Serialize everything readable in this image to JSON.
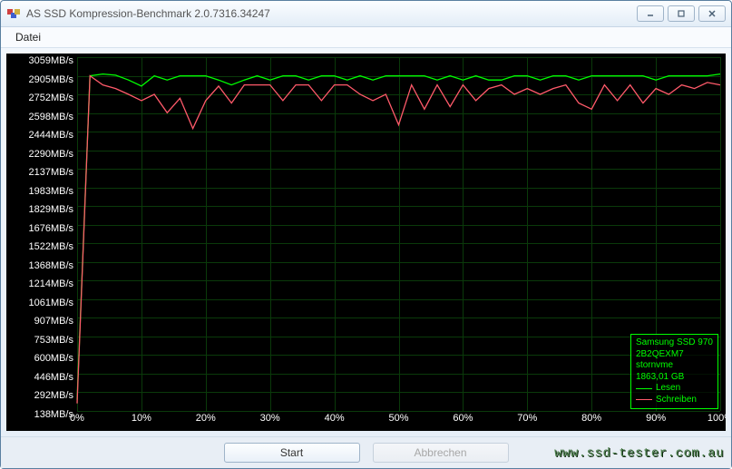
{
  "window": {
    "title": "AS SSD Kompression-Benchmark 2.0.7316.34247"
  },
  "menu": {
    "file": "Datei"
  },
  "buttons": {
    "start": "Start",
    "cancel": "Abbrechen"
  },
  "legend": {
    "device_line1": "Samsung SSD 970",
    "device_line2": "2B2QEXM7",
    "device_line3": "stornvme",
    "device_line4": "1863,01 GB",
    "read": "Lesen",
    "write": "Schreiben",
    "read_color": "#00ff00",
    "write_color": "#ff5a6a"
  },
  "watermark": "www.ssd-tester.com.au",
  "chart_data": {
    "type": "line",
    "title": "",
    "xlabel": "",
    "ylabel": "",
    "y_unit": "MB/s",
    "xlim": [
      0,
      100
    ],
    "ylim": [
      138,
      3059
    ],
    "y_ticks": [
      3059,
      2905,
      2752,
      2598,
      2444,
      2290,
      2137,
      1983,
      1829,
      1676,
      1522,
      1368,
      1214,
      1061,
      907,
      753,
      600,
      446,
      292,
      138
    ],
    "x_ticks": [
      0,
      10,
      20,
      30,
      40,
      50,
      60,
      70,
      80,
      90,
      100
    ],
    "x": [
      0,
      2,
      4,
      6,
      8,
      10,
      12,
      14,
      16,
      18,
      20,
      22,
      24,
      26,
      28,
      30,
      32,
      34,
      36,
      38,
      40,
      42,
      44,
      46,
      48,
      50,
      52,
      54,
      56,
      58,
      60,
      62,
      64,
      66,
      68,
      70,
      72,
      74,
      76,
      78,
      80,
      82,
      84,
      86,
      88,
      90,
      92,
      94,
      96,
      98,
      100
    ],
    "series": [
      {
        "name": "Lesen",
        "color": "#00ff00",
        "values": [
          230,
          2905,
          2920,
          2910,
          2870,
          2820,
          2905,
          2870,
          2905,
          2905,
          2905,
          2870,
          2830,
          2870,
          2905,
          2870,
          2905,
          2905,
          2870,
          2905,
          2905,
          2870,
          2905,
          2870,
          2905,
          2905,
          2905,
          2905,
          2870,
          2905,
          2870,
          2905,
          2870,
          2870,
          2905,
          2905,
          2870,
          2905,
          2905,
          2870,
          2905,
          2905,
          2905,
          2905,
          2905,
          2870,
          2905,
          2905,
          2905,
          2905,
          2920
        ]
      },
      {
        "name": "Schreiben",
        "color": "#ff5a6a",
        "values": [
          200,
          2905,
          2830,
          2800,
          2752,
          2700,
          2752,
          2600,
          2720,
          2470,
          2700,
          2820,
          2680,
          2830,
          2830,
          2830,
          2700,
          2830,
          2830,
          2700,
          2830,
          2830,
          2752,
          2700,
          2752,
          2500,
          2830,
          2630,
          2830,
          2650,
          2830,
          2700,
          2800,
          2830,
          2752,
          2800,
          2752,
          2800,
          2830,
          2680,
          2630,
          2830,
          2700,
          2830,
          2680,
          2800,
          2752,
          2830,
          2800,
          2850,
          2830
        ]
      }
    ]
  }
}
